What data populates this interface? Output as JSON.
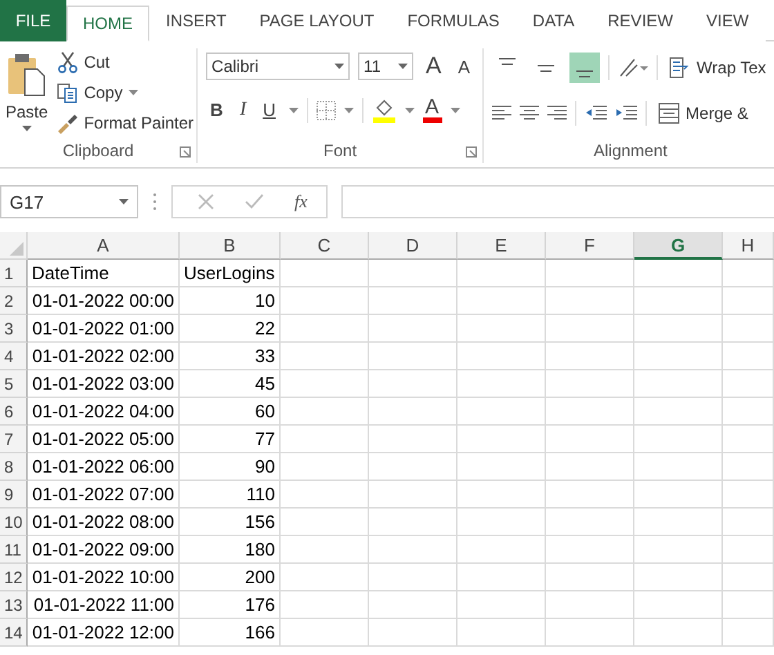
{
  "tabs": [
    {
      "label": "FILE",
      "kind": "file",
      "selected": false
    },
    {
      "label": "HOME",
      "kind": "tab",
      "selected": true
    },
    {
      "label": "INSERT",
      "kind": "tab",
      "selected": false
    },
    {
      "label": "PAGE LAYOUT",
      "kind": "tab",
      "selected": false
    },
    {
      "label": "FORMULAS",
      "kind": "tab",
      "selected": false
    },
    {
      "label": "DATA",
      "kind": "tab",
      "selected": false
    },
    {
      "label": "REVIEW",
      "kind": "tab",
      "selected": false
    },
    {
      "label": "VIEW",
      "kind": "tab",
      "selected": false
    }
  ],
  "clipboard": {
    "paste": "Paste",
    "cut": "Cut",
    "copy": "Copy",
    "format_painter": "Format Painter",
    "label": "Clipboard"
  },
  "font": {
    "name": "Calibri",
    "size": "11",
    "grow": "A",
    "shrink": "A",
    "bold": "B",
    "italic": "I",
    "underline": "U",
    "font_color": "A",
    "label": "Font"
  },
  "alignment": {
    "vertical": [
      {
        "selected": false
      },
      {
        "selected": false
      },
      {
        "selected": true
      }
    ],
    "wrap_text": "Wrap Tex",
    "merge": "Merge &",
    "label": "Alignment"
  },
  "name_box": "G17",
  "fx": "fx",
  "columns": [
    {
      "label": "A",
      "selected": false
    },
    {
      "label": "B",
      "selected": false
    },
    {
      "label": "C",
      "selected": false
    },
    {
      "label": "D",
      "selected": false
    },
    {
      "label": "E",
      "selected": false
    },
    {
      "label": "F",
      "selected": false
    },
    {
      "label": "G",
      "selected": true
    },
    {
      "label": "H",
      "selected": false
    }
  ],
  "rows": [
    {
      "number": "1",
      "kind": "header",
      "cells": [
        "DateTime",
        "UserLogins"
      ]
    },
    {
      "number": "2",
      "kind": "data",
      "cells": [
        "01-01-2022 00:00",
        "10"
      ]
    },
    {
      "number": "3",
      "kind": "data",
      "cells": [
        "01-01-2022 01:00",
        "22"
      ]
    },
    {
      "number": "4",
      "kind": "data",
      "cells": [
        "01-01-2022 02:00",
        "33"
      ]
    },
    {
      "number": "5",
      "kind": "data",
      "cells": [
        "01-01-2022 03:00",
        "45"
      ]
    },
    {
      "number": "6",
      "kind": "data",
      "cells": [
        "01-01-2022 04:00",
        "60"
      ]
    },
    {
      "number": "7",
      "kind": "data",
      "cells": [
        "01-01-2022 05:00",
        "77"
      ]
    },
    {
      "number": "8",
      "kind": "data",
      "cells": [
        "01-01-2022 06:00",
        "90"
      ]
    },
    {
      "number": "9",
      "kind": "data",
      "cells": [
        "01-01-2022 07:00",
        "110"
      ]
    },
    {
      "number": "10",
      "kind": "data",
      "cells": [
        "01-01-2022 08:00",
        "156"
      ]
    },
    {
      "number": "11",
      "kind": "data",
      "cells": [
        "01-01-2022 09:00",
        "180"
      ]
    },
    {
      "number": "12",
      "kind": "data",
      "cells": [
        "01-01-2022 10:00",
        "200"
      ]
    },
    {
      "number": "13",
      "kind": "data",
      "cells": [
        "01-01-2022 11:00",
        "176"
      ]
    },
    {
      "number": "14",
      "kind": "data",
      "cells": [
        "01-01-2022 12:00",
        "166"
      ]
    }
  ]
}
